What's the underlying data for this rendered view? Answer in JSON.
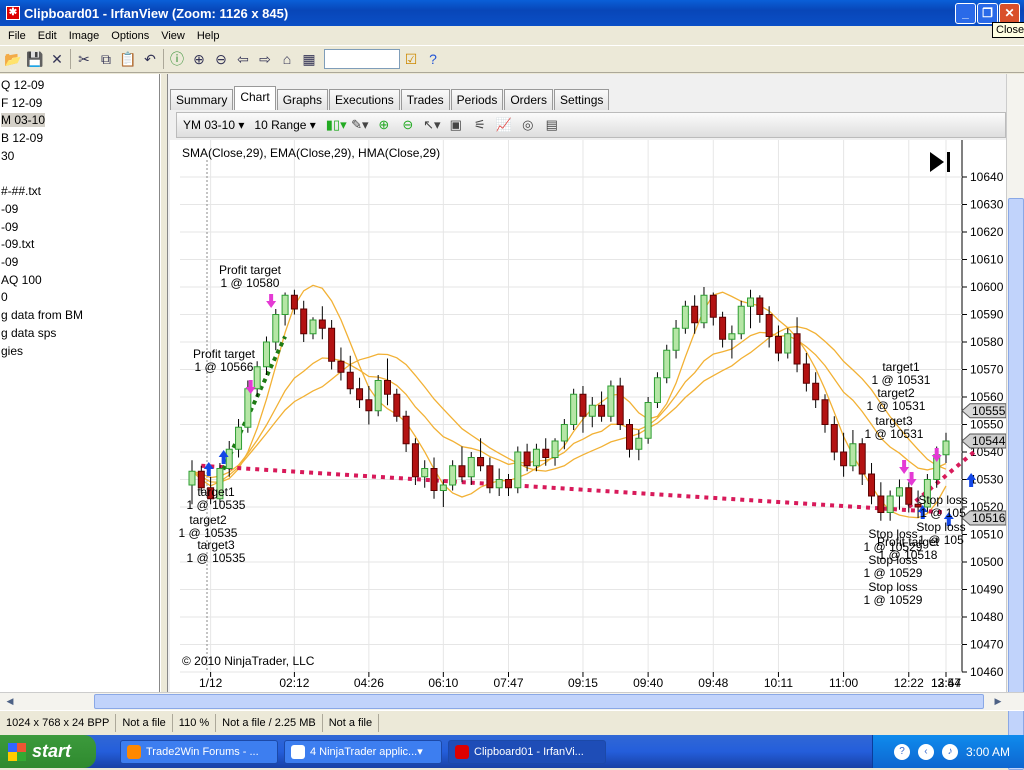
{
  "window": {
    "title": "Clipboard01 - IrfanView (Zoom: 1126 x 845)",
    "tooltip": "Close"
  },
  "menu": [
    "File",
    "Edit",
    "Image",
    "Options",
    "View",
    "Help"
  ],
  "left_list": [
    "Q 12-09",
    "F 12-09",
    "M 03-10",
    "B 12-09",
    " 30",
    "",
    "#-##.txt",
    "-09",
    "-09",
    "-09.txt",
    "-09",
    "AQ 100",
    "0",
    "g data from BM",
    "g data sps",
    "gies"
  ],
  "left_list_selected": 2,
  "nt": {
    "tabs": [
      "Summary",
      "Chart",
      "Graphs",
      "Executions",
      "Trades",
      "Periods",
      "Orders",
      "Settings"
    ],
    "active_tab": "Chart",
    "instrument": "YM 03-10",
    "period": "10 Range"
  },
  "chart_data": {
    "type": "candlestick",
    "indicator_label": "SMA(Close,29), EMA(Close,29), HMA(Close,29)",
    "copyright": "© 2010 NinjaTrader, LLC",
    "y_ticks": [
      10640,
      10630,
      10620,
      10610,
      10600,
      10590,
      10580,
      10570,
      10560,
      10550,
      10540,
      10530,
      10520,
      10510,
      10500,
      10490,
      10480,
      10470,
      10460
    ],
    "ylim": [
      10460,
      10645
    ],
    "x_ticks": [
      "1/12",
      "02:12",
      "04:26",
      "06:10",
      "07:47",
      "09:15",
      "09:40",
      "09:48",
      "10:11",
      "11:00",
      "12:22",
      "12:54",
      "13:47"
    ],
    "price_badges": [
      {
        "value": "10555",
        "price": 10555,
        "color": "#d8d8d8"
      },
      {
        "value": "10544",
        "price": 10544,
        "color": "#cfcfcf"
      },
      {
        "value": "10516",
        "price": 10516,
        "color": "#cfcfcf"
      }
    ],
    "ohlc": [
      [
        10528,
        10537,
        10521,
        10533
      ],
      [
        10533,
        10535,
        10525,
        10527
      ],
      [
        10527,
        10531,
        10521,
        10523
      ],
      [
        10523,
        10536,
        10520,
        10534
      ],
      [
        10534,
        10544,
        10531,
        10541
      ],
      [
        10541,
        10552,
        10538,
        10549
      ],
      [
        10549,
        10566,
        10547,
        10563
      ],
      [
        10563,
        10573,
        10560,
        10571
      ],
      [
        10571,
        10582,
        10568,
        10580
      ],
      [
        10580,
        10592,
        10577,
        10590
      ],
      [
        10590,
        10598,
        10586,
        10597
      ],
      [
        10597,
        10599,
        10590,
        10592
      ],
      [
        10592,
        10595,
        10580,
        10583
      ],
      [
        10583,
        10589,
        10581,
        10588
      ],
      [
        10588,
        10593,
        10581,
        10585
      ],
      [
        10585,
        10588,
        10570,
        10573
      ],
      [
        10573,
        10578,
        10566,
        10569
      ],
      [
        10569,
        10575,
        10561,
        10563
      ],
      [
        10563,
        10567,
        10556,
        10559
      ],
      [
        10559,
        10564,
        10550,
        10555
      ],
      [
        10555,
        10568,
        10553,
        10566
      ],
      [
        10566,
        10574,
        10557,
        10561
      ],
      [
        10561,
        10563,
        10551,
        10553
      ],
      [
        10553,
        10555,
        10540,
        10543
      ],
      [
        10543,
        10545,
        10528,
        10531
      ],
      [
        10531,
        10537,
        10527,
        10534
      ],
      [
        10534,
        10538,
        10523,
        10526
      ],
      [
        10526,
        10530,
        10520,
        10528
      ],
      [
        10528,
        10537,
        10526,
        10535
      ],
      [
        10535,
        10542,
        10529,
        10531
      ],
      [
        10531,
        10540,
        10528,
        10538
      ],
      [
        10538,
        10545,
        10533,
        10535
      ],
      [
        10535,
        10538,
        10525,
        10527
      ],
      [
        10527,
        10534,
        10524,
        10530
      ],
      [
        10530,
        10532,
        10524,
        10527
      ],
      [
        10527,
        10542,
        10525,
        10540
      ],
      [
        10540,
        10543,
        10533,
        10535
      ],
      [
        10535,
        10543,
        10533,
        10541
      ],
      [
        10541,
        10545,
        10535,
        10538
      ],
      [
        10538,
        10545,
        10535,
        10544
      ],
      [
        10544,
        10552,
        10541,
        10550
      ],
      [
        10550,
        10563,
        10548,
        10561
      ],
      [
        10561,
        10564,
        10547,
        10553
      ],
      [
        10553,
        10560,
        10549,
        10557
      ],
      [
        10557,
        10562,
        10551,
        10553
      ],
      [
        10553,
        10566,
        10551,
        10564
      ],
      [
        10564,
        10567,
        10548,
        10550
      ],
      [
        10550,
        10552,
        10538,
        10541
      ],
      [
        10541,
        10548,
        10537,
        10545
      ],
      [
        10545,
        10560,
        10543,
        10558
      ],
      [
        10558,
        10569,
        10556,
        10567
      ],
      [
        10567,
        10579,
        10565,
        10577
      ],
      [
        10577,
        10588,
        10574,
        10585
      ],
      [
        10585,
        10595,
        10583,
        10593
      ],
      [
        10593,
        10597,
        10583,
        10587
      ],
      [
        10587,
        10600,
        10585,
        10597
      ],
      [
        10597,
        10598,
        10586,
        10589
      ],
      [
        10589,
        10591,
        10578,
        10581
      ],
      [
        10581,
        10586,
        10574,
        10583
      ],
      [
        10583,
        10595,
        10581,
        10593
      ],
      [
        10593,
        10599,
        10585,
        10596
      ],
      [
        10596,
        10597,
        10587,
        10590
      ],
      [
        10590,
        10593,
        10578,
        10582
      ],
      [
        10582,
        10586,
        10573,
        10576
      ],
      [
        10576,
        10585,
        10574,
        10583
      ],
      [
        10583,
        10589,
        10569,
        10572
      ],
      [
        10572,
        10576,
        10562,
        10565
      ],
      [
        10565,
        10569,
        10556,
        10559
      ],
      [
        10559,
        10561,
        10547,
        10550
      ],
      [
        10550,
        10553,
        10537,
        10540
      ],
      [
        10540,
        10547,
        10531,
        10535
      ],
      [
        10535,
        10548,
        10533,
        10543
      ],
      [
        10543,
        10545,
        10528,
        10532
      ],
      [
        10532,
        10536,
        10521,
        10524
      ],
      [
        10524,
        10529,
        10515,
        10518
      ],
      [
        10518,
        10526,
        10515,
        10524
      ],
      [
        10524,
        10530,
        10519,
        10527
      ],
      [
        10527,
        10529,
        10518,
        10521
      ],
      [
        10521,
        10526,
        10516,
        10520
      ],
      [
        10520,
        10532,
        10518,
        10530
      ],
      [
        10530,
        10542,
        10527,
        10539
      ],
      [
        10539,
        10547,
        10536,
        10544
      ]
    ],
    "annotations": [
      {
        "text": "Profit target",
        "sub": "1 @ 10580"
      },
      {
        "text": "Profit target",
        "sub": "1 @ 10566"
      },
      {
        "text": "target1",
        "sub": "1 @ 10535"
      },
      {
        "text": "target2",
        "sub": "1 @ 10535"
      },
      {
        "text": "target3",
        "sub": "1 @ 10535"
      },
      {
        "text": "target1",
        "sub": "1 @ 10531"
      },
      {
        "text": "target2",
        "sub": "1 @ 10531"
      },
      {
        "text": "target3",
        "sub": "1 @ 10531"
      },
      {
        "text": "Stop loss",
        "sub": "1 @ 10529"
      },
      {
        "text": "Profit target",
        "sub": "1 @ 10518"
      },
      {
        "text": "Stop loss",
        "sub": "1 @ 10529"
      },
      {
        "text": "Stop loss",
        "sub": "1 @ 10529"
      },
      {
        "text": "Stop loss",
        "sub": "1 @ 105"
      },
      {
        "text": "Stop loss",
        "sub": "1 @ 105"
      }
    ]
  },
  "status": [
    "1024 x 768 x 24 BPP",
    "Not a file",
    "110 %",
    "Not a file / 2.25 MB",
    "Not a file"
  ],
  "taskbar": {
    "start": "start",
    "tasks": [
      "Trade2Win Forums - ...",
      "4 NinjaTrader applic...",
      "Clipboard01 - IrfanVi..."
    ],
    "clock": "3:00 AM"
  },
  "colors": {
    "up": "#2e9e33",
    "up_fill": "#b6e6a6",
    "down": "#b31212",
    "ma": "#f2b135",
    "trade_red": "#d81a5a",
    "trade_green": "#1e7a14",
    "buy": "#1347e6",
    "sell": "#e43ad4"
  }
}
